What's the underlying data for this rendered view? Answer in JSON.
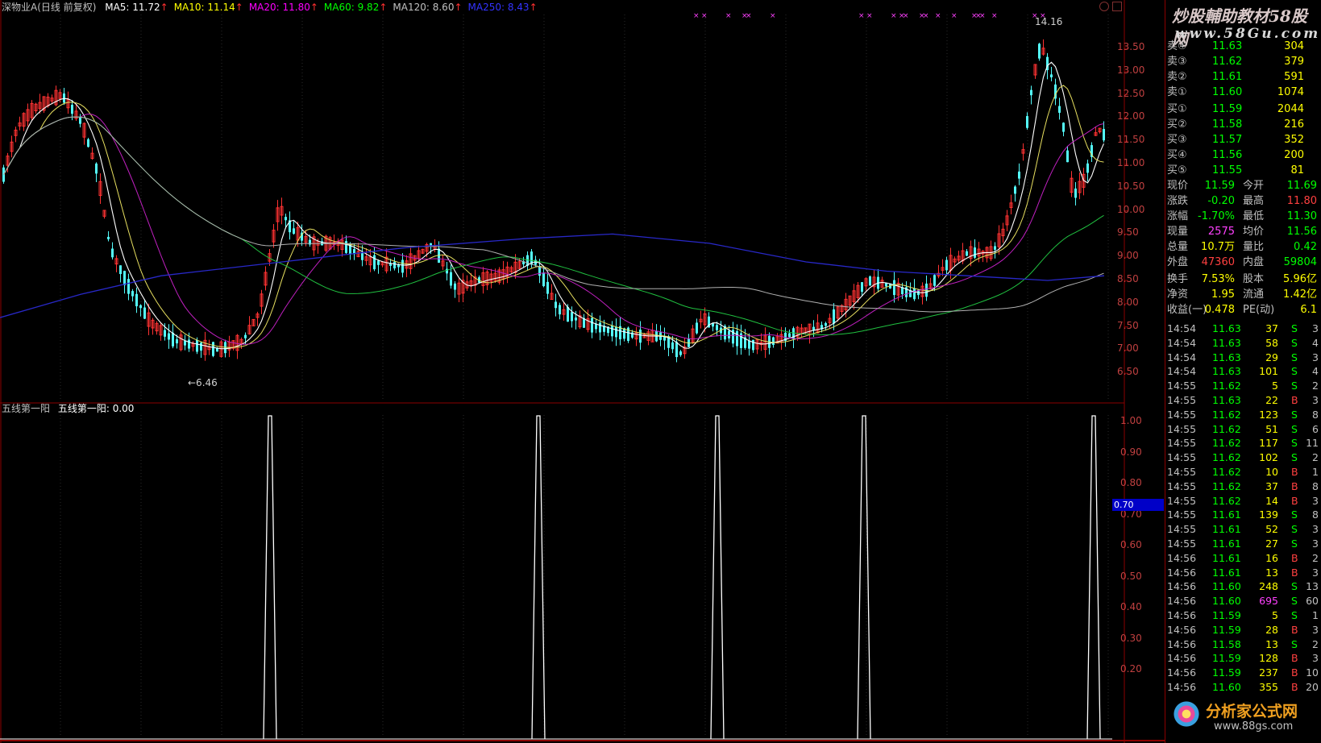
{
  "header": {
    "stock": "深物业A(日线 前复权)",
    "ma": [
      {
        "label": "MA5: 11.72",
        "color": "#ffffff"
      },
      {
        "label": "MA10: 11.14",
        "color": "#ffff00"
      },
      {
        "label": "MA20: 11.80",
        "color": "#ff00ff"
      },
      {
        "label": "MA60: 9.82",
        "color": "#00ff00"
      },
      {
        "label": "MA120: 8.60",
        "color": "#c0c0c0"
      },
      {
        "label": "MA250: 8.43",
        "color": "#3333ff"
      }
    ],
    "arrow": "↑"
  },
  "price_axis": [
    "13.50",
    "13.00",
    "12.50",
    "12.00",
    "11.50",
    "11.00",
    "10.50",
    "10.00",
    "9.50",
    "9.00",
    "8.50",
    "8.00",
    "7.50",
    "7.00",
    "6.50"
  ],
  "price_annotations": {
    "high": "14.16",
    "low": "←6.46"
  },
  "indicator": {
    "title": "五线第一阳",
    "value_label": "五线第一阳: 0.00",
    "axis": [
      "1.00",
      "0.90",
      "0.80",
      "0.70",
      "0.60",
      "0.50",
      "0.40",
      "0.30",
      "0.20"
    ],
    "current": "0.70"
  },
  "order_book": {
    "sells": [
      {
        "label": "卖④",
        "price": "11.63",
        "vol": "304"
      },
      {
        "label": "卖③",
        "price": "11.62",
        "vol": "379"
      },
      {
        "label": "卖②",
        "price": "11.61",
        "vol": "591"
      },
      {
        "label": "卖①",
        "price": "11.60",
        "vol": "1074"
      }
    ],
    "buys": [
      {
        "label": "买①",
        "price": "11.59",
        "vol": "2044"
      },
      {
        "label": "买②",
        "price": "11.58",
        "vol": "216"
      },
      {
        "label": "买③",
        "price": "11.57",
        "vol": "352"
      },
      {
        "label": "买④",
        "price": "11.56",
        "vol": "200"
      },
      {
        "label": "买⑤",
        "price": "11.55",
        "vol": "81"
      }
    ]
  },
  "quote": [
    {
      "l1": "现价",
      "v1": "11.59",
      "c1": "#00ff00",
      "l2": "今开",
      "v2": "11.69",
      "c2": "#00ff00"
    },
    {
      "l1": "涨跌",
      "v1": "-0.20",
      "c1": "#00ff00",
      "l2": "最高",
      "v2": "11.80",
      "c2": "#ff4040"
    },
    {
      "l1": "涨幅",
      "v1": "-1.70%",
      "c1": "#00ff00",
      "l2": "最低",
      "v2": "11.30",
      "c2": "#00ff00"
    },
    {
      "l1": "现量",
      "v1": "2575",
      "c1": "#ff40ff",
      "l2": "均价",
      "v2": "11.56",
      "c2": "#00ff00"
    },
    {
      "l1": "总量",
      "v1": "10.7万",
      "c1": "#ffff00",
      "l2": "量比",
      "v2": "0.42",
      "c2": "#00ff00"
    },
    {
      "l1": "外盘",
      "v1": "47360",
      "c1": "#ff4040",
      "l2": "内盘",
      "v2": "59804",
      "c2": "#00ff00"
    },
    {
      "l1": "换手",
      "v1": "7.53%",
      "c1": "#ffff00",
      "l2": "股本",
      "v2": "5.96亿",
      "c2": "#ffff00"
    },
    {
      "l1": "净资",
      "v1": "1.95",
      "c1": "#ffff00",
      "l2": "流通",
      "v2": "1.42亿",
      "c2": "#ffff00"
    },
    {
      "l1": "收益(一)",
      "v1": "0.478",
      "c1": "#ffff00",
      "l2": "PE(动)",
      "v2": "6.1",
      "c2": "#ffff00"
    }
  ],
  "ticks": [
    {
      "t": "14:54",
      "p": "11.63",
      "v": "37",
      "s": "S",
      "n": "3"
    },
    {
      "t": "14:54",
      "p": "11.63",
      "v": "58",
      "s": "S",
      "n": "4"
    },
    {
      "t": "14:54",
      "p": "11.63",
      "v": "29",
      "s": "S",
      "n": "3"
    },
    {
      "t": "14:54",
      "p": "11.63",
      "v": "101",
      "s": "S",
      "n": "4"
    },
    {
      "t": "14:55",
      "p": "11.62",
      "v": "5",
      "s": "S",
      "n": "2"
    },
    {
      "t": "14:55",
      "p": "11.63",
      "v": "22",
      "s": "B",
      "n": "3"
    },
    {
      "t": "14:55",
      "p": "11.62",
      "v": "123",
      "s": "S",
      "n": "8"
    },
    {
      "t": "14:55",
      "p": "11.62",
      "v": "51",
      "s": "S",
      "n": "6"
    },
    {
      "t": "14:55",
      "p": "11.62",
      "v": "117",
      "s": "S",
      "n": "11"
    },
    {
      "t": "14:55",
      "p": "11.62",
      "v": "102",
      "s": "S",
      "n": "2"
    },
    {
      "t": "14:55",
      "p": "11.62",
      "v": "10",
      "s": "B",
      "n": "1"
    },
    {
      "t": "14:55",
      "p": "11.62",
      "v": "37",
      "s": "B",
      "n": "8"
    },
    {
      "t": "14:55",
      "p": "11.62",
      "v": "14",
      "s": "B",
      "n": "3"
    },
    {
      "t": "14:55",
      "p": "11.61",
      "v": "139",
      "s": "S",
      "n": "8"
    },
    {
      "t": "14:55",
      "p": "11.61",
      "v": "52",
      "s": "S",
      "n": "3"
    },
    {
      "t": "14:55",
      "p": "11.61",
      "v": "27",
      "s": "S",
      "n": "3"
    },
    {
      "t": "14:56",
      "p": "11.61",
      "v": "16",
      "s": "B",
      "n": "2"
    },
    {
      "t": "14:56",
      "p": "11.61",
      "v": "13",
      "s": "B",
      "n": "3"
    },
    {
      "t": "14:56",
      "p": "11.60",
      "v": "248",
      "s": "S",
      "n": "13"
    },
    {
      "t": "14:56",
      "p": "11.60",
      "v": "695",
      "s": "S",
      "n": "60"
    },
    {
      "t": "14:56",
      "p": "11.59",
      "v": "5",
      "s": "S",
      "n": "1"
    },
    {
      "t": "14:56",
      "p": "11.59",
      "v": "28",
      "s": "B",
      "n": "3"
    },
    {
      "t": "14:56",
      "p": "11.58",
      "v": "13",
      "s": "S",
      "n": "2"
    },
    {
      "t": "14:56",
      "p": "11.59",
      "v": "128",
      "s": "B",
      "n": "3"
    },
    {
      "t": "14:56",
      "p": "11.59",
      "v": "237",
      "s": "B",
      "n": "10"
    },
    {
      "t": "14:56",
      "p": "11.60",
      "v": "355",
      "s": "B",
      "n": "20"
    }
  ],
  "watermarks": {
    "top": "炒股輔助教材58股网",
    "top_url": "www.58Gu.com",
    "bottom": "分析家公式网",
    "bottom_url": "www.88gs.com"
  },
  "colors": {
    "up": "#ff3232",
    "down": "#54fcfc",
    "grid_red": "#8b0000",
    "axis_text": "#c04040"
  }
}
